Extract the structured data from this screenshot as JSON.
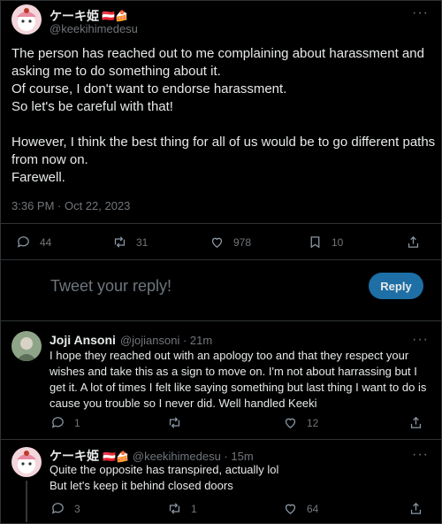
{
  "main_tweet": {
    "author_name": "ケーキ姫",
    "author_badges": "🇦🇹🍰",
    "handle": "@keekihimedesu",
    "lines": [
      "The person has reached out to me complaining about harassment and",
      "asking me to do something about it.",
      "Of course, I don't want to endorse harassment.",
      "So let's be careful with that!",
      "",
      "However, I think the best thing for all of us would be to go different paths",
      "from now on.",
      "Farewell."
    ],
    "timestamp": "3:36 PM · Oct 22, 2023",
    "stats": {
      "replies": "44",
      "retweets": "31",
      "likes": "978",
      "bookmarks": "10"
    }
  },
  "reply_box": {
    "placeholder": "Tweet your reply!",
    "button_label": "Reply"
  },
  "replies": [
    {
      "author_name": "Joji Ansoni",
      "handle": "@jojiansoni · 21m",
      "lines": [
        "I hope they reached out with an apology too and that they respect your",
        "wishes and take this as a sign to move on. I'm not about harrassing but I",
        "get it. A lot of times I felt like saying something but last thing I want to do is",
        "cause you trouble so I never did. Well handled Keeki"
      ],
      "stats": {
        "replies": "1",
        "retweets": "",
        "likes": "12"
      }
    },
    {
      "author_name": "ケーキ姫",
      "author_badges": "🇦🇹🍰",
      "handle": "@keekihimedesu · 15m",
      "lines": [
        "Quite the opposite has transpired, actually lol",
        "But let's keep it behind closed doors"
      ],
      "stats": {
        "replies": "3",
        "retweets": "1",
        "likes": "64"
      }
    }
  ],
  "icons": [
    "reply-icon",
    "retweet-icon",
    "like-icon",
    "bookmark-icon",
    "share-icon",
    "more-icon"
  ],
  "colors": {
    "background": "#000000",
    "text": "#e7e9ea",
    "muted": "#71767b",
    "accent": "#1d6fa5",
    "border": "#2f3336"
  }
}
